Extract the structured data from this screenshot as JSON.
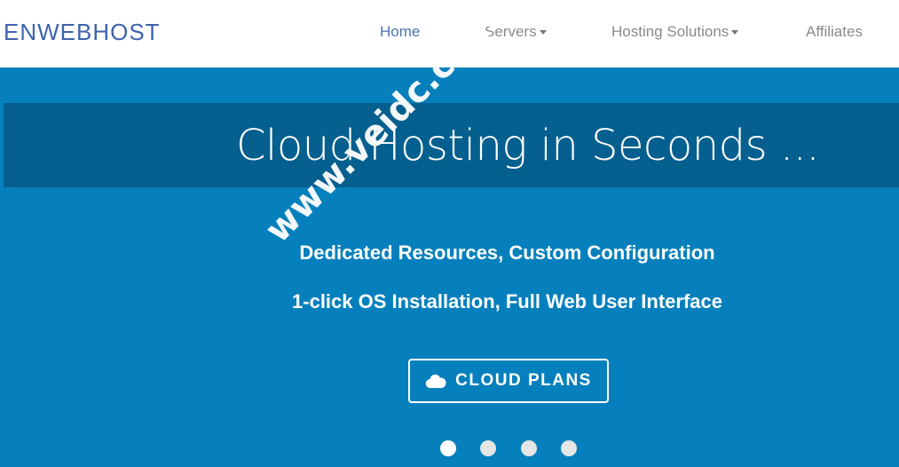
{
  "brand": {
    "logo": "ENWEBHOST"
  },
  "nav": {
    "items": [
      {
        "label": "Home",
        "active": true,
        "dropdown": false
      },
      {
        "label": "Servers",
        "active": false,
        "dropdown": true
      },
      {
        "label": "Hosting Solutions",
        "active": false,
        "dropdown": true
      },
      {
        "label": "Affiliates",
        "active": false,
        "dropdown": false
      }
    ]
  },
  "hero": {
    "title": "Cloud Hosting in Seconds ...",
    "features": [
      "Dedicated Resources, Custom Configuration",
      "1-click OS Installation, Full Web User Interface"
    ],
    "cta": {
      "label": "CLOUD PLANS",
      "icon": "cloud-icon"
    },
    "slider": {
      "slide_count": 4,
      "active_index": 0
    }
  },
  "watermark": "www.veidc.com",
  "colors": {
    "hero_bg": "#0680bc",
    "banner_bg": "#055f8f",
    "logo": "#3f63ad",
    "nav_active": "#4a74b5",
    "nav_text": "#8a8a8a"
  }
}
